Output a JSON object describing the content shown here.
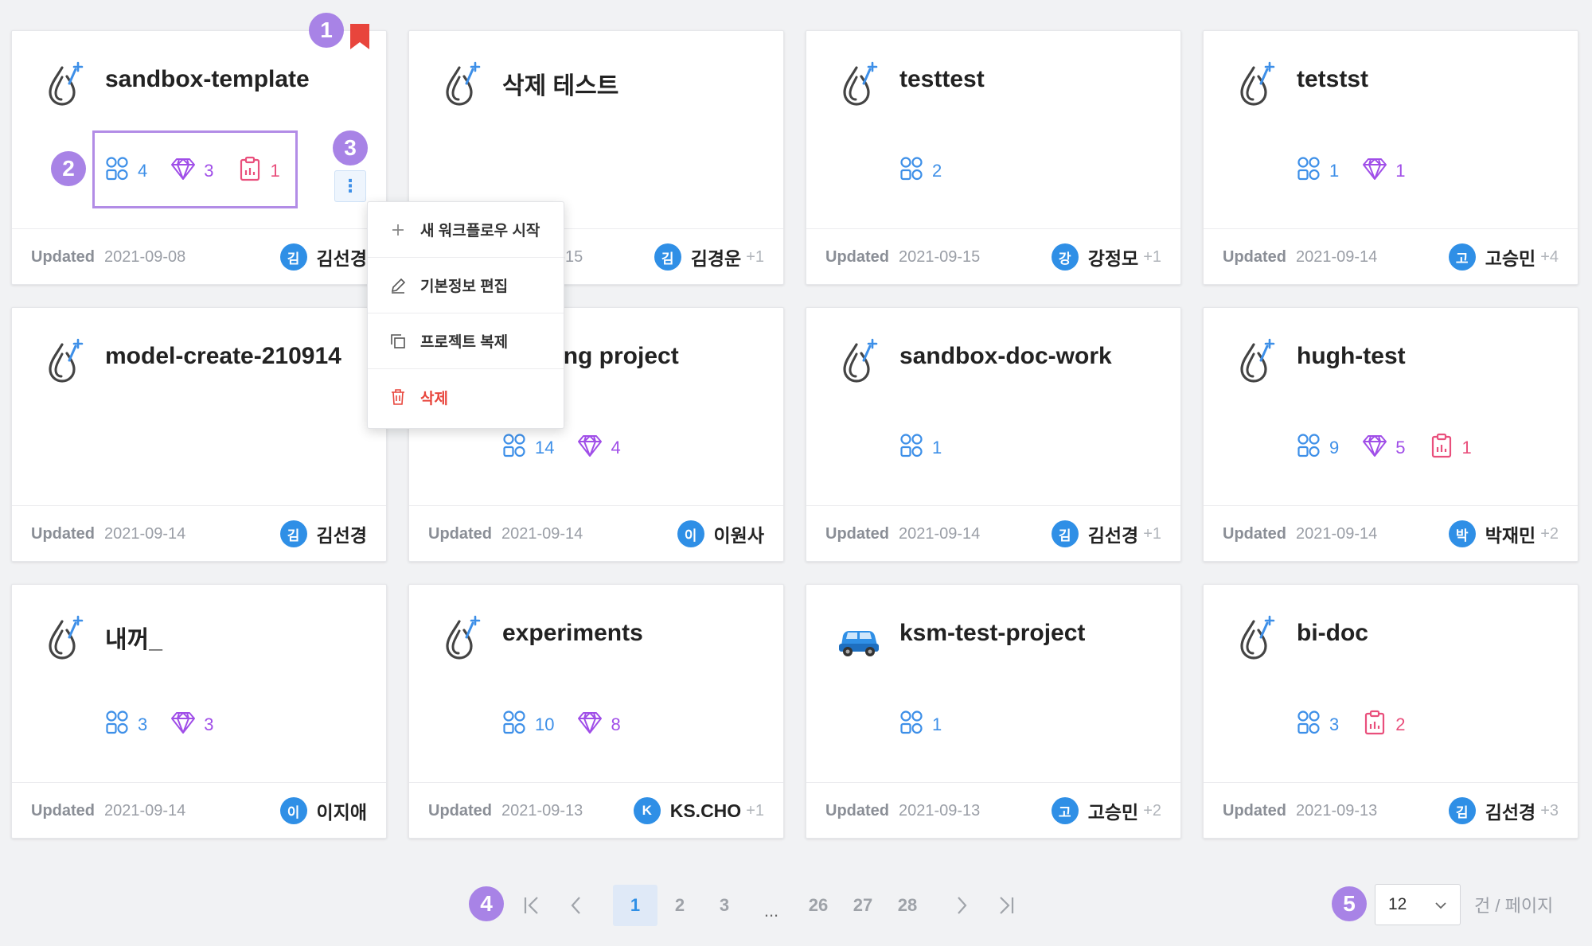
{
  "cards": [
    {
      "title": "sandbox-template",
      "logo": "drop-sparkle",
      "workflows": "4",
      "models": "3",
      "datasets": "1",
      "updated": "2021-09-08",
      "avatar": "김",
      "owner": "김선경",
      "extra": ""
    },
    {
      "title": "삭제 테스트",
      "logo": "drop-sparkle",
      "workflows": "",
      "models": "",
      "datasets": "",
      "updated": "2021-09-15",
      "avatar": "김",
      "owner": "김경운",
      "extra": "+1"
    },
    {
      "title": "testtest",
      "logo": "drop-sparkle",
      "workflows": "2",
      "models": "",
      "datasets": "",
      "updated": "2021-09-15",
      "avatar": "강",
      "owner": "강정모",
      "extra": "+1"
    },
    {
      "title": "tetstst",
      "logo": "drop-sparkle",
      "workflows": "1",
      "models": "1",
      "datasets": "",
      "updated": "2021-09-14",
      "avatar": "고",
      "owner": "고승민",
      "extra": "+4"
    },
    {
      "title": "model-create-210914",
      "logo": "drop-sparkle",
      "workflows": "",
      "models": "",
      "datasets": "",
      "updated": "2021-09-14",
      "avatar": "김",
      "owner": "김선경",
      "extra": ""
    },
    {
      "title": "abelling project",
      "logo": "drop-sparkle",
      "workflows": "14",
      "models": "4",
      "datasets": "",
      "updated": "2021-09-14",
      "avatar": "이",
      "owner": "이원사",
      "extra": ""
    },
    {
      "title": "sandbox-doc-work",
      "logo": "drop-sparkle",
      "workflows": "1",
      "models": "",
      "datasets": "",
      "updated": "2021-09-14",
      "avatar": "김",
      "owner": "김선경",
      "extra": "+1"
    },
    {
      "title": "hugh-test",
      "logo": "drop-sparkle",
      "workflows": "9",
      "models": "5",
      "datasets": "1",
      "updated": "2021-09-14",
      "avatar": "박",
      "owner": "박재민",
      "extra": "+2"
    },
    {
      "title": "내꺼_",
      "logo": "drop-sparkle",
      "workflows": "3",
      "models": "3",
      "datasets": "",
      "updated": "2021-09-14",
      "avatar": "이",
      "owner": "이지애",
      "extra": ""
    },
    {
      "title": "experiments",
      "logo": "drop-sparkle",
      "workflows": "10",
      "models": "8",
      "datasets": "",
      "updated": "2021-09-13",
      "avatar": "K",
      "owner": "KS.CHO",
      "extra": "+1"
    },
    {
      "title": "ksm-test-project",
      "logo": "car-emoji",
      "workflows": "1",
      "models": "",
      "datasets": "",
      "updated": "2021-09-13",
      "avatar": "고",
      "owner": "고승민",
      "extra": "+2"
    },
    {
      "title": "bi-doc",
      "logo": "drop-sparkle",
      "workflows": "3",
      "models": "",
      "datasets": "2",
      "updated": "2021-09-13",
      "avatar": "김",
      "owner": "김선경",
      "extra": "+3"
    }
  ],
  "updated_label": "Updated",
  "menu": [
    {
      "icon": "plus-icon",
      "label": "새 워크플로우 시작"
    },
    {
      "icon": "pencil-icon",
      "label": "기본정보 편집"
    },
    {
      "icon": "copy-icon",
      "label": "프로젝트 복제"
    },
    {
      "icon": "trash-icon",
      "label": "삭제"
    }
  ],
  "badges": [
    "1",
    "2",
    "3",
    "4",
    "5"
  ],
  "pagination": {
    "first": "|<",
    "prev": "<",
    "pages": [
      "1",
      "2",
      "3"
    ],
    "dots": "...",
    "pages_end": [
      "26",
      "27",
      "28"
    ],
    "next": ">",
    "last": ">|",
    "current": "1"
  },
  "per_page": {
    "value": "12",
    "label": "건 / 페이지"
  },
  "colors": {
    "workflow": "#3d8fe8",
    "model": "#a04ee8",
    "dataset": "#e94f7c",
    "badge": "#a883e6",
    "bookmark": "#e8453c"
  }
}
